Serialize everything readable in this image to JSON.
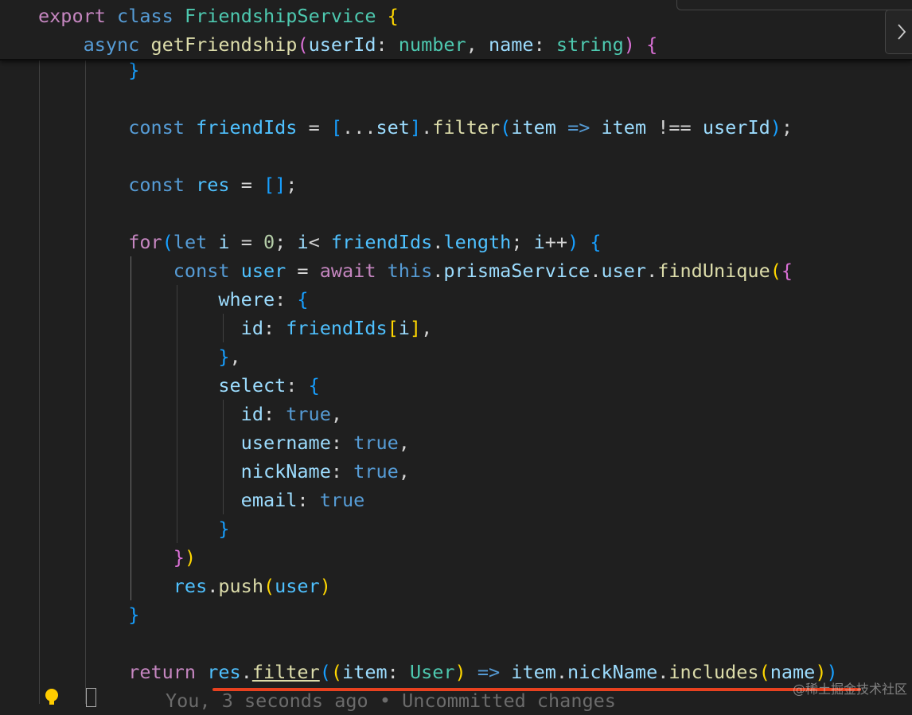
{
  "code": {
    "sticky_lines": [
      [
        {
          "t": "export",
          "c": "ctl"
        },
        {
          "t": " ",
          "c": "op"
        },
        {
          "t": "class",
          "c": "kw"
        },
        {
          "t": " ",
          "c": "op"
        },
        {
          "t": "FriendshipService",
          "c": "cls"
        },
        {
          "t": " ",
          "c": "op"
        },
        {
          "t": "{",
          "c": "b1"
        }
      ],
      [
        {
          "t": "    ",
          "c": "op"
        },
        {
          "t": "async",
          "c": "kw"
        },
        {
          "t": " ",
          "c": "op"
        },
        {
          "t": "getFriendship",
          "c": "fn"
        },
        {
          "t": "(",
          "c": "b2"
        },
        {
          "t": "userId",
          "c": "var"
        },
        {
          "t": ": ",
          "c": "op"
        },
        {
          "t": "number",
          "c": "cls"
        },
        {
          "t": ", ",
          "c": "op"
        },
        {
          "t": "name",
          "c": "var"
        },
        {
          "t": ": ",
          "c": "op"
        },
        {
          "t": "string",
          "c": "cls"
        },
        {
          "t": ")",
          "c": "b2"
        },
        {
          "t": " ",
          "c": "op"
        },
        {
          "t": "{",
          "c": "b2"
        }
      ]
    ],
    "lines": [
      [
        {
          "t": "        ",
          "c": "op"
        },
        {
          "t": "}",
          "c": "b3"
        }
      ],
      [],
      [
        {
          "t": "        ",
          "c": "op"
        },
        {
          "t": "const",
          "c": "kw"
        },
        {
          "t": " ",
          "c": "op"
        },
        {
          "t": "friendIds",
          "c": "cst"
        },
        {
          "t": " = ",
          "c": "op"
        },
        {
          "t": "[",
          "c": "b3"
        },
        {
          "t": "...",
          "c": "op"
        },
        {
          "t": "set",
          "c": "var"
        },
        {
          "t": "]",
          "c": "b3"
        },
        {
          "t": ".",
          "c": "op"
        },
        {
          "t": "filter",
          "c": "fn"
        },
        {
          "t": "(",
          "c": "b3"
        },
        {
          "t": "item",
          "c": "var"
        },
        {
          "t": " ",
          "c": "op"
        },
        {
          "t": "=>",
          "c": "kw"
        },
        {
          "t": " ",
          "c": "op"
        },
        {
          "t": "item",
          "c": "var"
        },
        {
          "t": " !== ",
          "c": "op"
        },
        {
          "t": "userId",
          "c": "var"
        },
        {
          "t": ")",
          "c": "b3"
        },
        {
          "t": ";",
          "c": "op"
        }
      ],
      [],
      [
        {
          "t": "        ",
          "c": "op"
        },
        {
          "t": "const",
          "c": "kw"
        },
        {
          "t": " ",
          "c": "op"
        },
        {
          "t": "res",
          "c": "cst"
        },
        {
          "t": " = ",
          "c": "op"
        },
        {
          "t": "[]",
          "c": "b3"
        },
        {
          "t": ";",
          "c": "op"
        }
      ],
      [],
      [
        {
          "t": "        ",
          "c": "op"
        },
        {
          "t": "for",
          "c": "ctl"
        },
        {
          "t": "(",
          "c": "b3"
        },
        {
          "t": "let",
          "c": "kw"
        },
        {
          "t": " ",
          "c": "op"
        },
        {
          "t": "i",
          "c": "var"
        },
        {
          "t": " = ",
          "c": "op"
        },
        {
          "t": "0",
          "c": "num"
        },
        {
          "t": "; ",
          "c": "op"
        },
        {
          "t": "i",
          "c": "var"
        },
        {
          "t": "< ",
          "c": "op"
        },
        {
          "t": "friendIds",
          "c": "cst"
        },
        {
          "t": ".",
          "c": "op"
        },
        {
          "t": "length",
          "c": "cst"
        },
        {
          "t": "; ",
          "c": "op"
        },
        {
          "t": "i",
          "c": "var"
        },
        {
          "t": "++",
          "c": "op"
        },
        {
          "t": ")",
          "c": "b3"
        },
        {
          "t": " ",
          "c": "op"
        },
        {
          "t": "{",
          "c": "b3"
        }
      ],
      [
        {
          "t": "            ",
          "c": "op"
        },
        {
          "t": "const",
          "c": "kw"
        },
        {
          "t": " ",
          "c": "op"
        },
        {
          "t": "user",
          "c": "cst"
        },
        {
          "t": " = ",
          "c": "op"
        },
        {
          "t": "await",
          "c": "ctl"
        },
        {
          "t": " ",
          "c": "op"
        },
        {
          "t": "this",
          "c": "kw"
        },
        {
          "t": ".",
          "c": "op"
        },
        {
          "t": "prismaService",
          "c": "var"
        },
        {
          "t": ".",
          "c": "op"
        },
        {
          "t": "user",
          "c": "var"
        },
        {
          "t": ".",
          "c": "op"
        },
        {
          "t": "findUnique",
          "c": "fn"
        },
        {
          "t": "(",
          "c": "b1"
        },
        {
          "t": "{",
          "c": "b2"
        }
      ],
      [
        {
          "t": "                ",
          "c": "op"
        },
        {
          "t": "where",
          "c": "var"
        },
        {
          "t": ": ",
          "c": "op"
        },
        {
          "t": "{",
          "c": "b3"
        }
      ],
      [
        {
          "t": "                  ",
          "c": "op"
        },
        {
          "t": "id",
          "c": "var"
        },
        {
          "t": ": ",
          "c": "op"
        },
        {
          "t": "friendIds",
          "c": "cst"
        },
        {
          "t": "[",
          "c": "b1"
        },
        {
          "t": "i",
          "c": "var"
        },
        {
          "t": "]",
          "c": "b1"
        },
        {
          "t": ",",
          "c": "op"
        }
      ],
      [
        {
          "t": "                ",
          "c": "op"
        },
        {
          "t": "}",
          "c": "b3"
        },
        {
          "t": ",",
          "c": "op"
        }
      ],
      [
        {
          "t": "                ",
          "c": "op"
        },
        {
          "t": "select",
          "c": "var"
        },
        {
          "t": ": ",
          "c": "op"
        },
        {
          "t": "{",
          "c": "b3"
        }
      ],
      [
        {
          "t": "                  ",
          "c": "op"
        },
        {
          "t": "id",
          "c": "var"
        },
        {
          "t": ": ",
          "c": "op"
        },
        {
          "t": "true",
          "c": "kw"
        },
        {
          "t": ",",
          "c": "op"
        }
      ],
      [
        {
          "t": "                  ",
          "c": "op"
        },
        {
          "t": "username",
          "c": "var"
        },
        {
          "t": ": ",
          "c": "op"
        },
        {
          "t": "true",
          "c": "kw"
        },
        {
          "t": ",",
          "c": "op"
        }
      ],
      [
        {
          "t": "                  ",
          "c": "op"
        },
        {
          "t": "nickName",
          "c": "var"
        },
        {
          "t": ": ",
          "c": "op"
        },
        {
          "t": "true",
          "c": "kw"
        },
        {
          "t": ",",
          "c": "op"
        }
      ],
      [
        {
          "t": "                  ",
          "c": "op"
        },
        {
          "t": "email",
          "c": "var"
        },
        {
          "t": ": ",
          "c": "op"
        },
        {
          "t": "true",
          "c": "kw"
        }
      ],
      [
        {
          "t": "                ",
          "c": "op"
        },
        {
          "t": "}",
          "c": "b3"
        }
      ],
      [
        {
          "t": "            ",
          "c": "op"
        },
        {
          "t": "}",
          "c": "b2"
        },
        {
          "t": ")",
          "c": "b1"
        }
      ],
      [
        {
          "t": "            ",
          "c": "op"
        },
        {
          "t": "res",
          "c": "cst"
        },
        {
          "t": ".",
          "c": "op"
        },
        {
          "t": "push",
          "c": "fn"
        },
        {
          "t": "(",
          "c": "b1"
        },
        {
          "t": "user",
          "c": "cst"
        },
        {
          "t": ")",
          "c": "b1"
        }
      ],
      [
        {
          "t": "        ",
          "c": "op"
        },
        {
          "t": "}",
          "c": "b3"
        }
      ],
      [],
      [
        {
          "t": "        ",
          "c": "op"
        },
        {
          "t": "return",
          "c": "ctl"
        },
        {
          "t": " ",
          "c": "op"
        },
        {
          "t": "res",
          "c": "cst"
        },
        {
          "t": ".",
          "c": "op"
        },
        {
          "t": "filter",
          "c": "fn",
          "u": true
        },
        {
          "t": "(",
          "c": "b3"
        },
        {
          "t": "(",
          "c": "b1"
        },
        {
          "t": "item",
          "c": "var"
        },
        {
          "t": ": ",
          "c": "op"
        },
        {
          "t": "User",
          "c": "cls"
        },
        {
          "t": ")",
          "c": "b1"
        },
        {
          "t": " ",
          "c": "op"
        },
        {
          "t": "=>",
          "c": "kw"
        },
        {
          "t": " ",
          "c": "op"
        },
        {
          "t": "item",
          "c": "var"
        },
        {
          "t": ".",
          "c": "op"
        },
        {
          "t": "nickName",
          "c": "var"
        },
        {
          "t": ".",
          "c": "op"
        },
        {
          "t": "includes",
          "c": "fn"
        },
        {
          "t": "(",
          "c": "b1"
        },
        {
          "t": "name",
          "c": "var"
        },
        {
          "t": ")",
          "c": "b1"
        },
        {
          "t": ")",
          "c": "b3"
        }
      ]
    ]
  },
  "blame": "You, 3 seconds ago • Uncommitted changes",
  "watermark": "@稀土掘金技术社区",
  "icons": {
    "bulb": "lightbulb-icon",
    "chevron": "chevron-right-icon"
  },
  "colors": {
    "background": "#1f1f1f",
    "underline": "#e8411f"
  }
}
